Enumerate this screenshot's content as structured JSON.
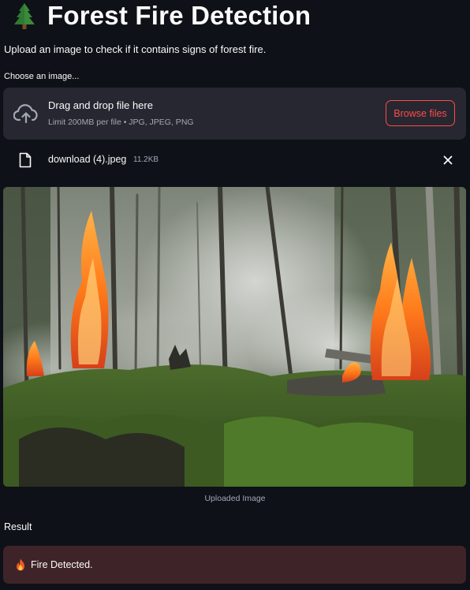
{
  "header": {
    "title": "Forest Fire Detection",
    "title_icon": "tree-icon",
    "subtitle": "Upload an image to check if it contains signs of forest fire."
  },
  "uploader": {
    "label": "Choose an image...",
    "dropzone_title": "Drag and drop file here",
    "dropzone_limit": "Limit 200MB per file • JPG, JPEG, PNG",
    "browse_label": "Browse files",
    "upload_icon": "cloud-upload-icon"
  },
  "uploaded_file": {
    "name": "download (4).jpeg",
    "size": "11.2KB",
    "file_icon": "file-icon",
    "remove_icon": "close-icon"
  },
  "image": {
    "caption": "Uploaded Image"
  },
  "result": {
    "label": "Result",
    "message": "Fire Detected.",
    "message_icon": "fire-icon"
  },
  "colors": {
    "background": "#0e1117",
    "surface": "#262730",
    "accent": "#ff4b4b",
    "muted_text": "#a3a8b8",
    "error_background": "#3e2428"
  }
}
